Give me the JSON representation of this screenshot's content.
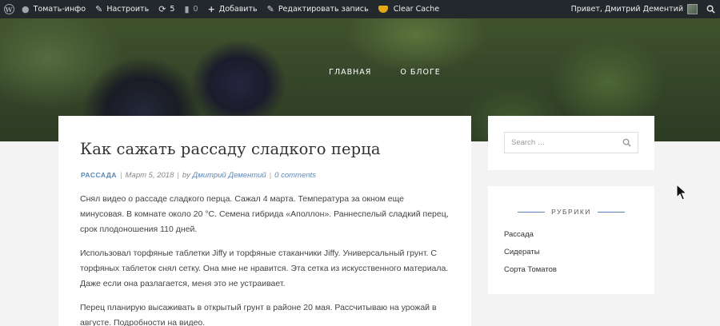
{
  "adminbar": {
    "site_name": "Томать-инфо",
    "customize": "Настроить",
    "updates_count": "5",
    "comments_count": "0",
    "add_new": "Добавить",
    "edit_post": "Редактировать запись",
    "clear_cache": "Clear Cache",
    "greeting": "Привет, Дмитрий Дементий"
  },
  "nav": {
    "home": "ГЛАВНАЯ",
    "about": "О БЛОГЕ"
  },
  "post": {
    "title": "Как сажать рассаду сладкого перца",
    "category": "РАССАДА",
    "date": "Март 5, 2018",
    "by": "by",
    "author": "Дмитрий Дементий",
    "comments": "0 comments",
    "paragraphs": [
      "Снял видео о рассаде сладкого перца. Сажал 4 марта. Температура за окном еще минусовая. В комнате около 20 °С. Семена гибрида «Аполлон». Раннеспелый сладкий перец, срок плодоношения 110 дней.",
      "Использовал торфяные таблетки Jiffy и торфяные стаканчики Jiffy. Универсальный грунт. С торфяных таблеток снял сетку. Она мне не нравится. Эта сетка из искусственного материала. Даже если она разлагается, меня это не устраивает.",
      "Перец планирую высаживать в открытый грунт в районе 20 мая. Рассчитываю на урожай в августе. Подробности на видео."
    ]
  },
  "sidebar": {
    "search_placeholder": "Search …",
    "categories_title": "РУБРИКИ",
    "categories": [
      "Рассада",
      "Сидераты",
      "Сорта Томатов"
    ]
  }
}
